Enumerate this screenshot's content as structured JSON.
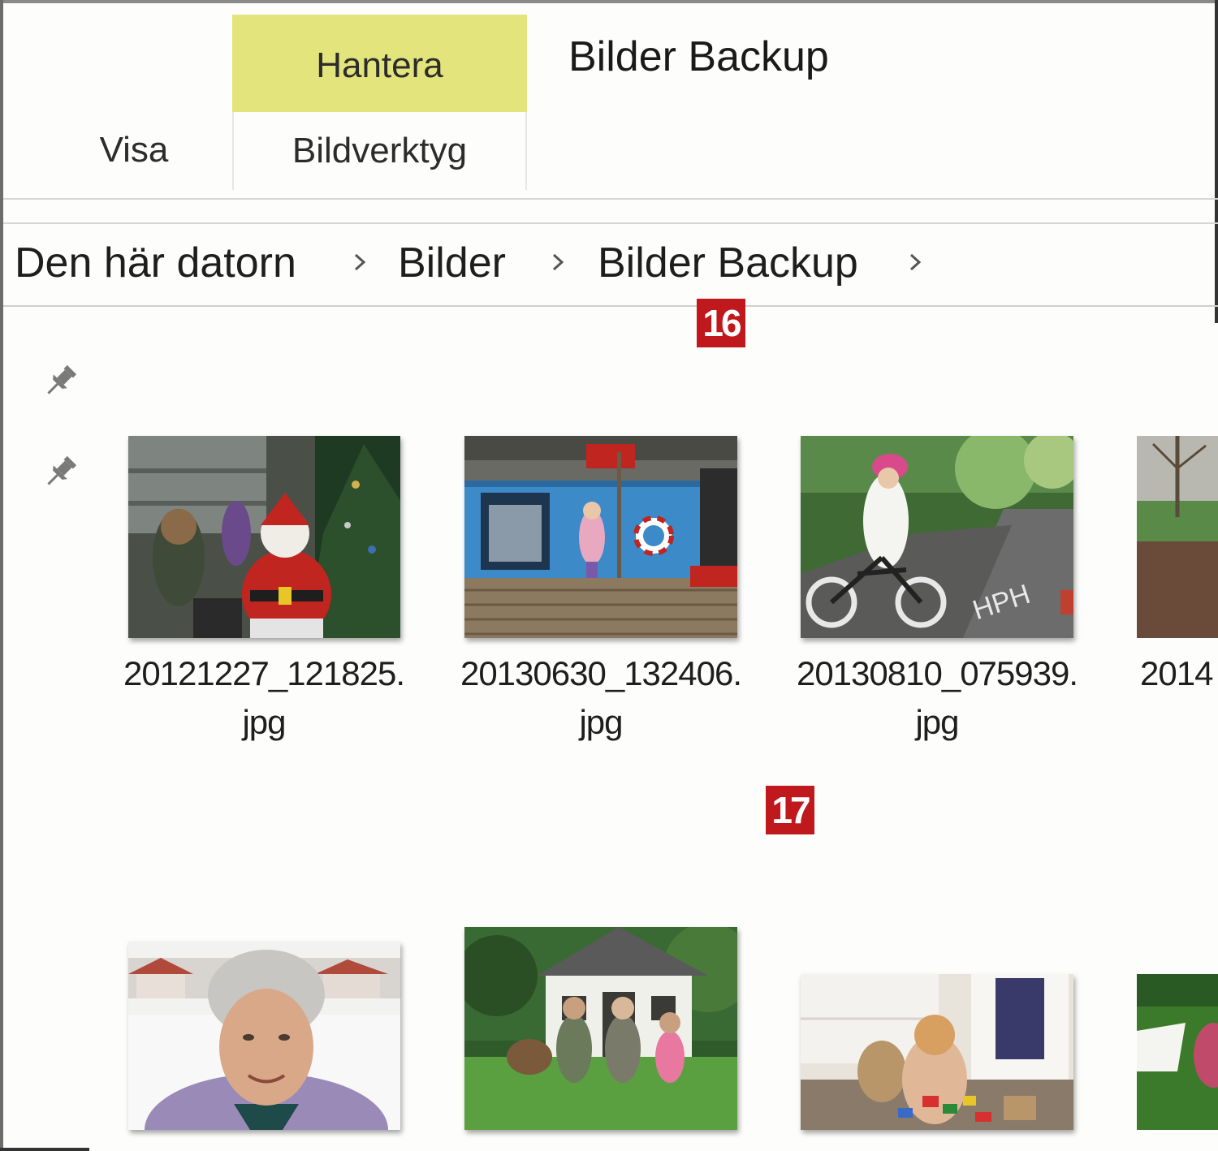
{
  "ribbon": {
    "contextual_tab": "Hantera",
    "window_title": "Bilder Backup",
    "tabs": [
      {
        "label": "Visa"
      },
      {
        "label": "Bildverktyg"
      }
    ]
  },
  "breadcrumb": [
    "Den här datorn",
    "Bilder",
    "Bilder Backup"
  ],
  "badges": [
    "16",
    "17"
  ],
  "files": [
    {
      "name": "20121227_121825.",
      "ext": "jpg"
    },
    {
      "name": "20130630_132406.",
      "ext": "jpg"
    },
    {
      "name": "20130810_075939.",
      "ext": "jpg"
    },
    {
      "name": "2014",
      "ext": ""
    }
  ],
  "icons": {
    "pin": "pin-icon",
    "chevron": "chevron-right-icon"
  },
  "colors": {
    "contextual_tab": "#e4e47c",
    "badge": "#c0191d"
  }
}
